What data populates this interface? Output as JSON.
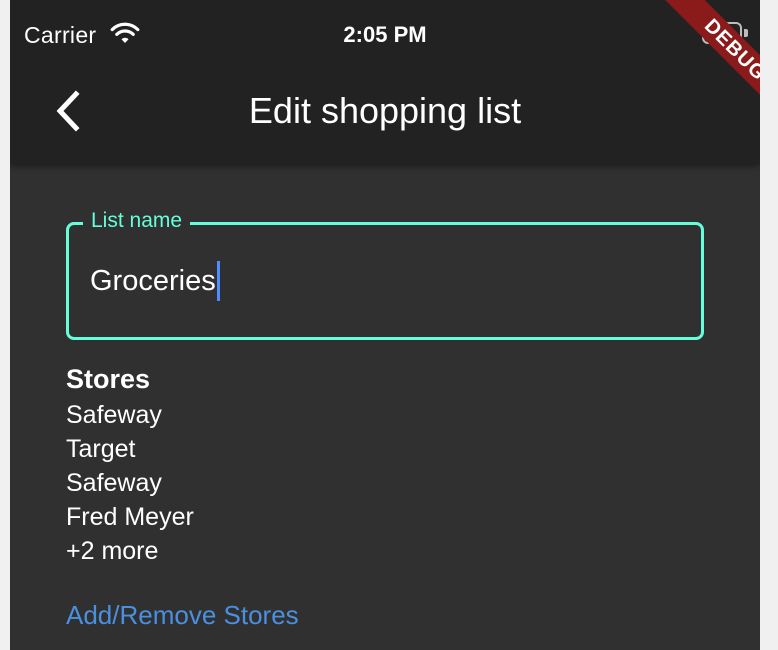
{
  "status_bar": {
    "carrier": "Carrier",
    "time": "2:05 PM",
    "wifi_icon": "wifi-icon",
    "battery_icon": "battery-icon"
  },
  "app_bar": {
    "back_icon": "chevron-left-icon",
    "title": "Edit shopping list"
  },
  "debug_banner": {
    "label": "DEBUG",
    "color": "#8b1a1a"
  },
  "form": {
    "list_name": {
      "label": "List name",
      "value": "Groceries",
      "accent_color": "#64ffda"
    },
    "stores": {
      "heading": "Stores",
      "items": [
        "Safeway",
        "Target",
        "Safeway",
        "Fred Meyer",
        "+2 more"
      ]
    },
    "add_remove_label": "Add/Remove Stores"
  },
  "colors": {
    "background": "#303030",
    "app_bar": "#222222",
    "link": "#4a8fe0",
    "caret": "#4c8dff"
  }
}
